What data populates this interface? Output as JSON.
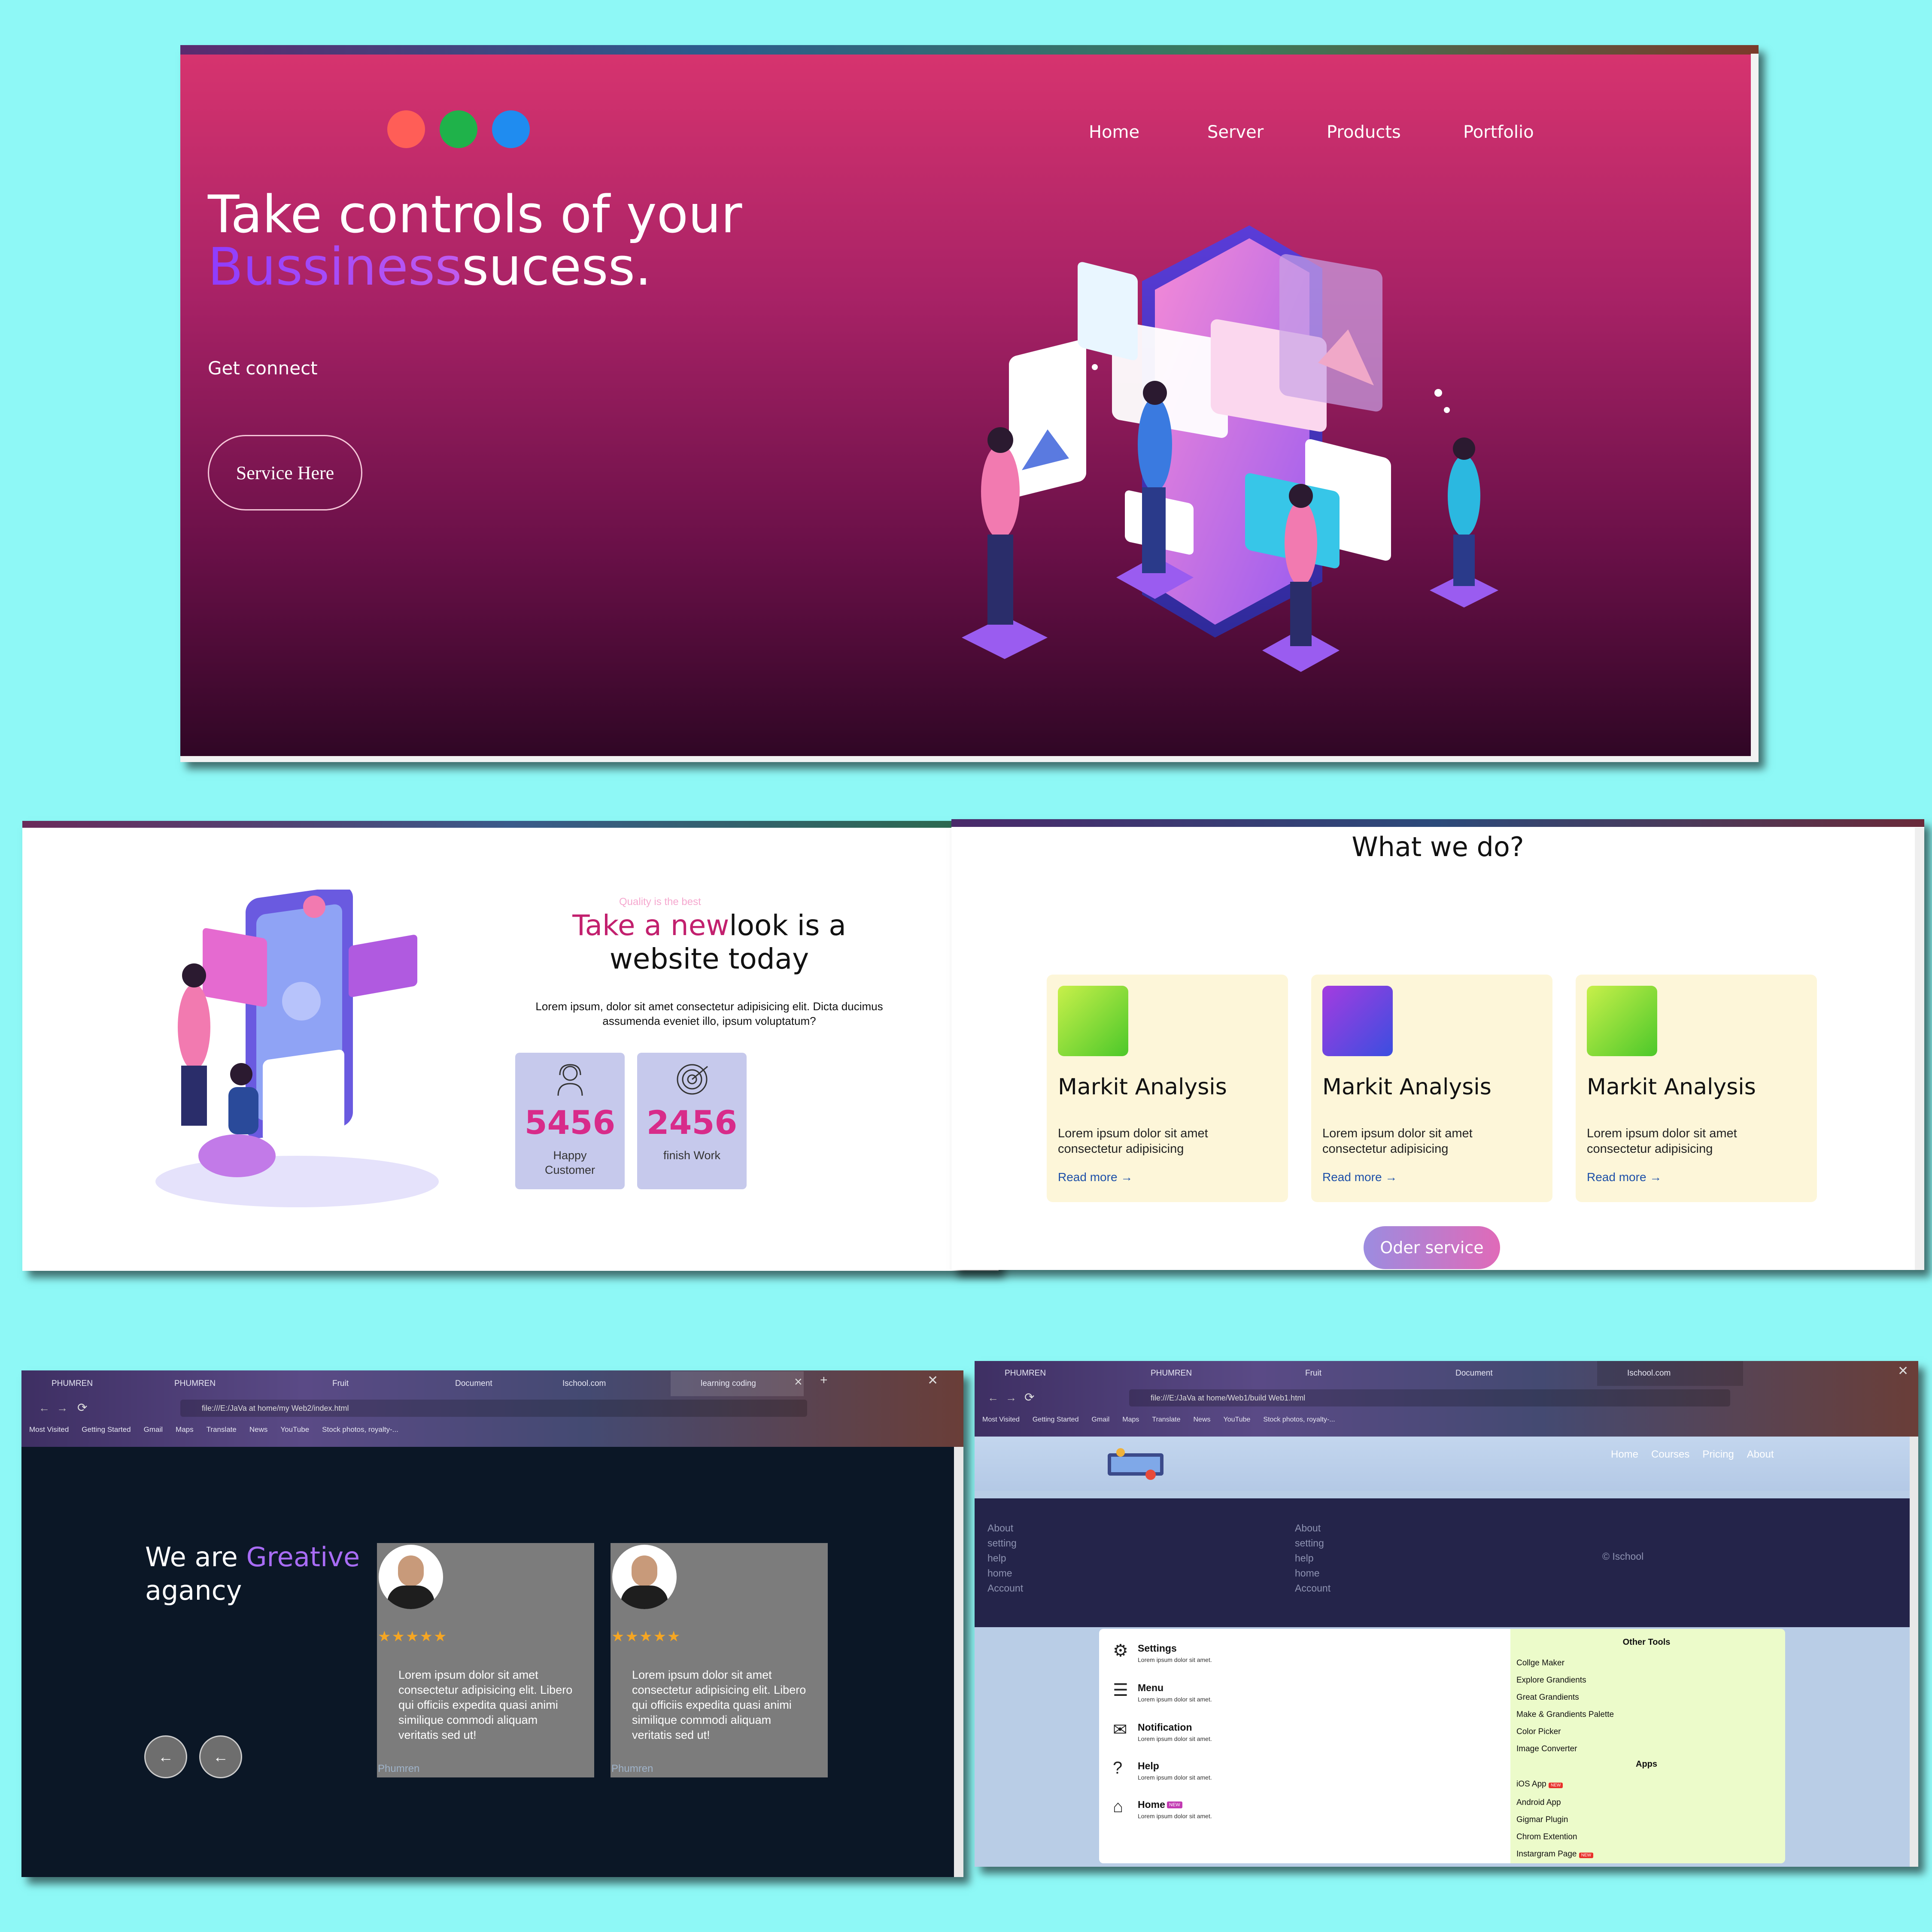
{
  "panel1": {
    "dots": [
      "#ff5e57",
      "#1fb24a",
      "#1f8cf0"
    ],
    "nav": [
      "Home",
      "Server",
      "Products",
      "Portfolio"
    ],
    "headline_line1": "Take controls of your",
    "headline_purple": "Bussiness",
    "headline_rest": "sucess.",
    "subtext": "Get connect",
    "button": "Service Here"
  },
  "panel2": {
    "eyebrow": "Quality is the best",
    "title_pink": "Take a new",
    "title_rest": "look is a",
    "title_line2": "website today",
    "paragraph": "Lorem ipsum, dolor sit amet consectetur adipisicing elit. Dicta ducimus assumenda eveniet illo, ipsum voluptatum?",
    "stats": [
      {
        "value": "5456",
        "label1": "Happy",
        "label2": "Customer",
        "icon": "support-agent-icon"
      },
      {
        "value": "2456",
        "label1": "finish Work",
        "label2": "",
        "icon": "target-icon"
      }
    ]
  },
  "panel3": {
    "title": "What we do?",
    "services": [
      {
        "title": "Markit Analysis",
        "desc1": "Lorem ipsum dolor sit amet",
        "desc2": "consectetur adipisicing",
        "link": "Read more",
        "color": "green"
      },
      {
        "title": "Markit Analysis",
        "desc1": "Lorem ipsum dolor sit amet",
        "desc2": "consectetur adipisicing",
        "link": "Read more",
        "color": "purple"
      },
      {
        "title": "Markit Analysis",
        "desc1": "Lorem ipsum dolor sit amet",
        "desc2": "consectetur adipisicing",
        "link": "Read more",
        "color": "green"
      }
    ],
    "button": "Oder service"
  },
  "panel4": {
    "tabs": [
      "PHUMREN",
      "PHUMREN",
      "Fruit",
      "Document",
      "Ischool.com",
      "learning coding"
    ],
    "url": "file:///E:/JaVa at home/my Web2/index.html",
    "bookmarks": [
      "Most Visited",
      "Getting Started",
      "Gmail",
      "Maps",
      "Translate",
      "News",
      "YouTube",
      "Stock photos, royalty-..."
    ],
    "heading_white1": "We are ",
    "heading_purple": "Greative",
    "heading_white2": "agancy",
    "stars": "★★★★★",
    "review": "Lorem ipsum dolor sit amet consectetur adipisicing elit. Libero qui officiis expedita quasi animi similique commodi aliquam veritatis sed ut!",
    "reviewer": "Phumren"
  },
  "panel5": {
    "tabs": [
      "PHUMREN",
      "PHUMREN",
      "Fruit",
      "Document",
      "Ischool.com"
    ],
    "url": "file:///E:/JaVa at home/Web1/build Web1.html",
    "bookmarks": [
      "Most Visited",
      "Getting Started",
      "Gmail",
      "Maps",
      "Translate",
      "News",
      "YouTube",
      "Stock photos, royalty-..."
    ],
    "nav": [
      "Home",
      "Courses",
      "Pricing",
      "About"
    ],
    "footer_col": [
      "About",
      "setting",
      "help",
      "home",
      "Account"
    ],
    "copyright": "© Ischool",
    "menu": [
      {
        "title": "Settings",
        "desc": "Lorem ipsum dolor sit amet.",
        "icon": "gear-icon",
        "badge": ""
      },
      {
        "title": "Menu",
        "desc": "Lorem ipsum dolor sit amet.",
        "icon": "menu-icon",
        "badge": ""
      },
      {
        "title": "Notification",
        "desc": "Lorem ipsum dolor sit amet.",
        "icon": "envelope-icon",
        "badge": ""
      },
      {
        "title": "Help",
        "desc": "Lorem ipsum dolor sit amet.",
        "icon": "help-icon",
        "badge": ""
      },
      {
        "title": "Home",
        "desc": "Lorem ipsum dolor sit amet.",
        "icon": "home-icon",
        "badge": "NEW"
      }
    ],
    "other_tools_title": "Other Tools",
    "other_tools": [
      "Collge Maker",
      "Explore Grandients",
      "Great Grandients",
      "Make & Grandients Palette",
      "Color Picker",
      "Image Converter"
    ],
    "apps_title": "Apps",
    "apps": [
      {
        "name": "iOS App",
        "badge": "NEW"
      },
      {
        "name": "Android App",
        "badge": ""
      },
      {
        "name": "Gigmar Plugin",
        "badge": ""
      },
      {
        "name": "Chrom Extention",
        "badge": ""
      },
      {
        "name": "Instargram Page",
        "badge": "NEW"
      }
    ]
  }
}
